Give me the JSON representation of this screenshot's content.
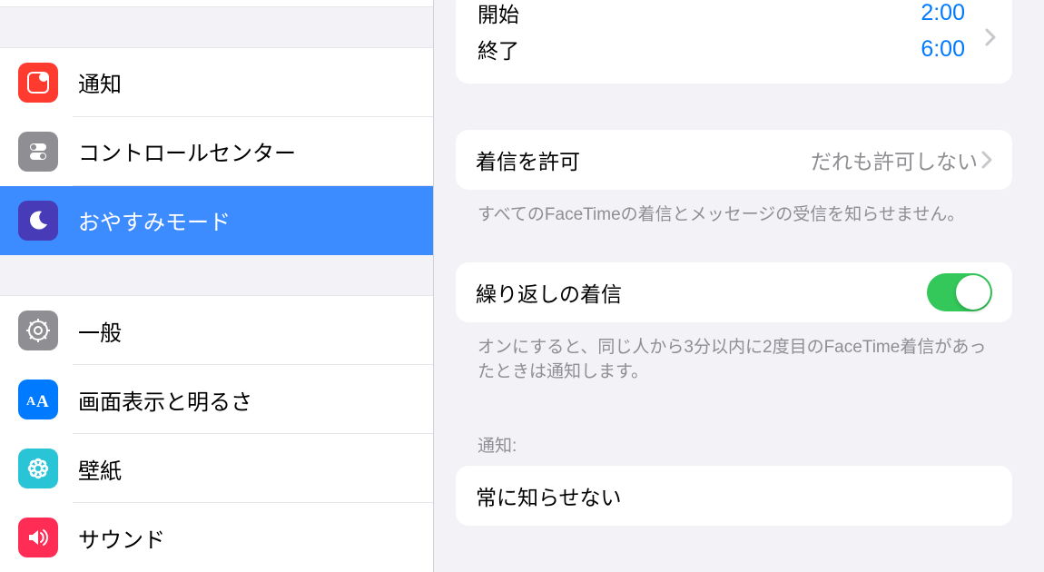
{
  "sidebar": {
    "items1": [
      {
        "label": "通知"
      },
      {
        "label": "コントロールセンター"
      },
      {
        "label": "おやすみモード"
      }
    ],
    "items2": [
      {
        "label": "一般"
      },
      {
        "label": "画面表示と明るさ"
      },
      {
        "label": "壁紙"
      },
      {
        "label": "サウンド"
      }
    ]
  },
  "detail": {
    "schedule": {
      "start_label": "開始",
      "start_value": "2:00",
      "end_label": "終了",
      "end_value": "6:00"
    },
    "allow_calls": {
      "label": "着信を許可",
      "value": "だれも許可しない"
    },
    "allow_calls_footer": "すべてのFaceTimeの着信とメッセージの受信を知らせません。",
    "repeat_calls": {
      "label": "繰り返しの着信"
    },
    "repeat_calls_footer": "オンにすると、同じ人から3分以内に2度目のFaceTime着信があったときは通知します。",
    "notify_header": "通知:",
    "always_block": {
      "label": "常に知らせない"
    }
  }
}
